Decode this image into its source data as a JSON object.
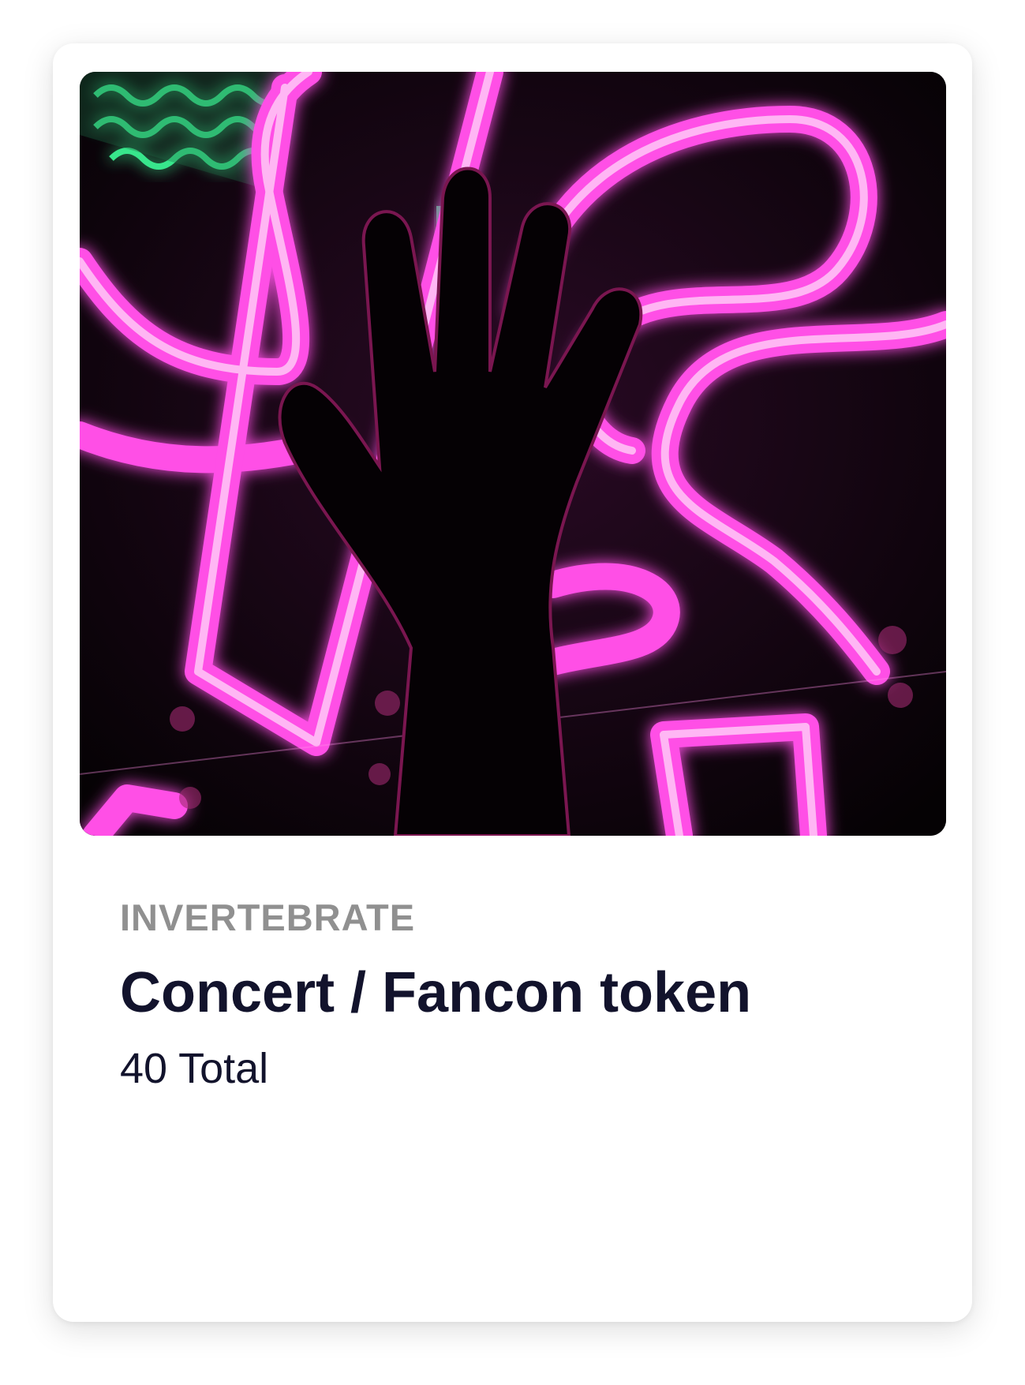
{
  "card": {
    "collection": "INVERTEBRATE",
    "title": "Concert / Fancon token",
    "count": "40 Total",
    "image": {
      "alt": "hand-against-neon-sign-image"
    }
  },
  "colors": {
    "neon_pink": "#ff4fe6",
    "neon_green": "#3dff9a",
    "title_text": "#12132c",
    "label_text": "#909090"
  }
}
